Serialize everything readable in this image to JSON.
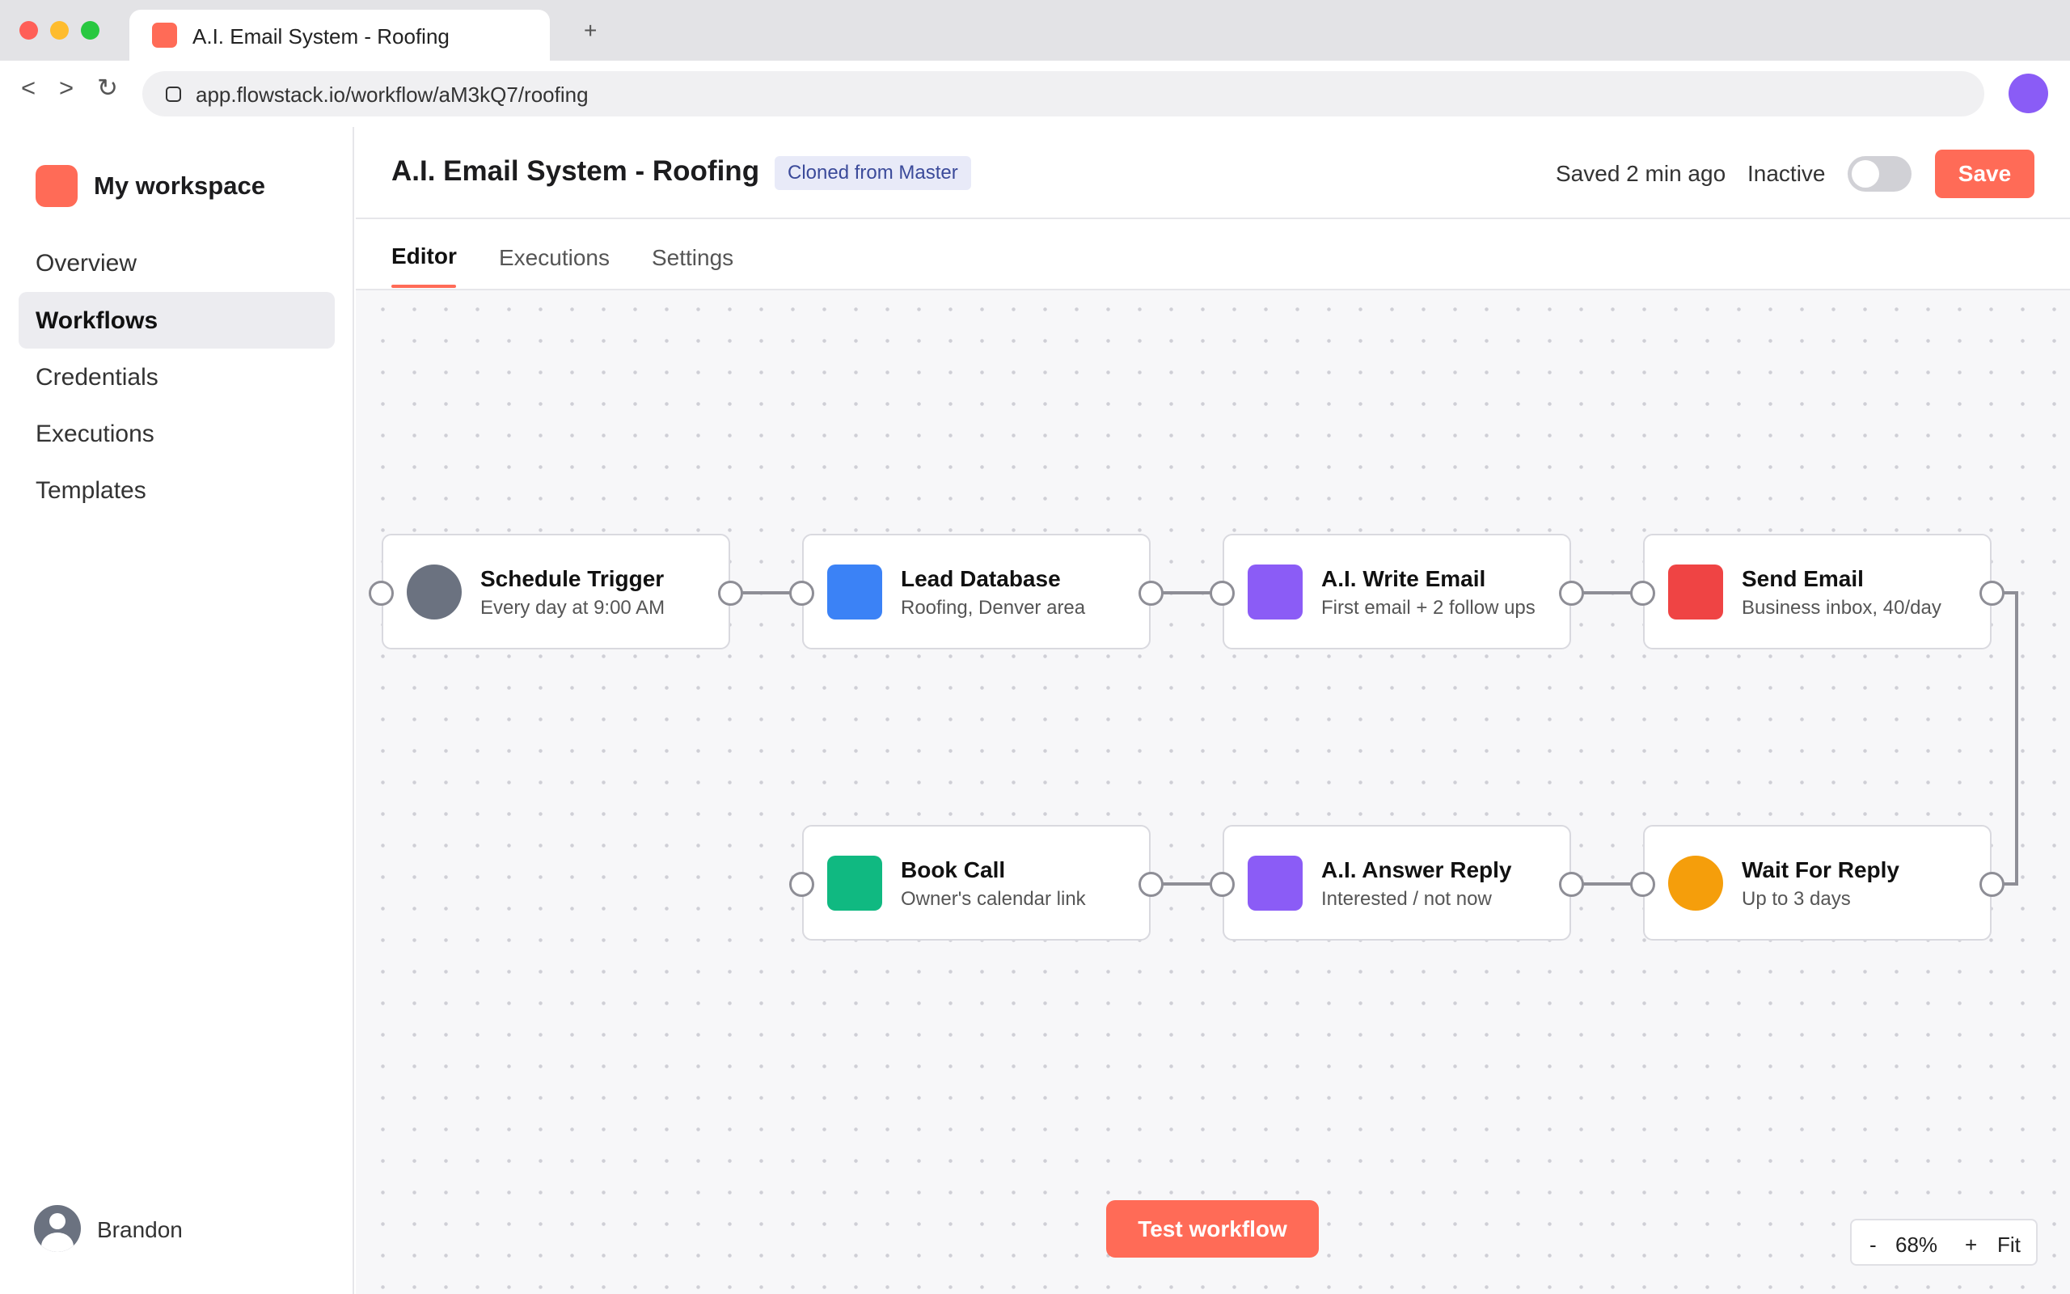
{
  "browser": {
    "tab_title": "A.I. Email System - Roofing",
    "new_tab": "+",
    "back": "<",
    "forward": ">",
    "reload": "↻",
    "url": "app.flowstack.io/workflow/aM3kQ7/roofing"
  },
  "sidebar": {
    "workspace": "My workspace",
    "items": [
      {
        "label": "Overview",
        "active": false
      },
      {
        "label": "Workflows",
        "active": true
      },
      {
        "label": "Credentials",
        "active": false
      },
      {
        "label": "Executions",
        "active": false
      },
      {
        "label": "Templates",
        "active": false
      }
    ],
    "user": "Brandon"
  },
  "header": {
    "title": "A.I. Email System - Roofing",
    "badge": "Cloned from Master",
    "saved": "Saved 2 min ago",
    "status": "Inactive",
    "active": false,
    "save_label": "Save"
  },
  "tabs": [
    "Editor",
    "Executions",
    "Settings"
  ],
  "nodes": [
    {
      "title": "Schedule Trigger",
      "subtitle": "Every day at 9:00 AM",
      "icon": "clock-icon",
      "color": "#6b7280"
    },
    {
      "title": "Lead Database",
      "subtitle": "Roofing, Denver area",
      "icon": "database-icon",
      "color": "#3b82f6"
    },
    {
      "title": "A.I. Write Email",
      "subtitle": "First email + 2 follow ups",
      "icon": "ai-icon",
      "color": "#8b5cf6"
    },
    {
      "title": "Send Email",
      "subtitle": "Business inbox, 40/day",
      "icon": "mail-icon",
      "color": "#ef4444"
    },
    {
      "title": "Book Call",
      "subtitle": "Owner's calendar link",
      "icon": "calendar-icon",
      "color": "#10b981"
    },
    {
      "title": "A.I. Answer Reply",
      "subtitle": "Interested / not now",
      "icon": "ai-icon",
      "color": "#8b5cf6"
    },
    {
      "title": "Wait For Reply",
      "subtitle": "Up to 3 days",
      "icon": "timer-icon",
      "color": "#f59e0b"
    }
  ],
  "test_label": "Test workflow",
  "zoom": {
    "minus": "-",
    "level": "68%",
    "plus": "+",
    "fit": "Fit"
  },
  "colors": {
    "accent": "#ff6b57",
    "badge_bg": "#e8eaf8",
    "badge_text": "#3b4a9a"
  }
}
